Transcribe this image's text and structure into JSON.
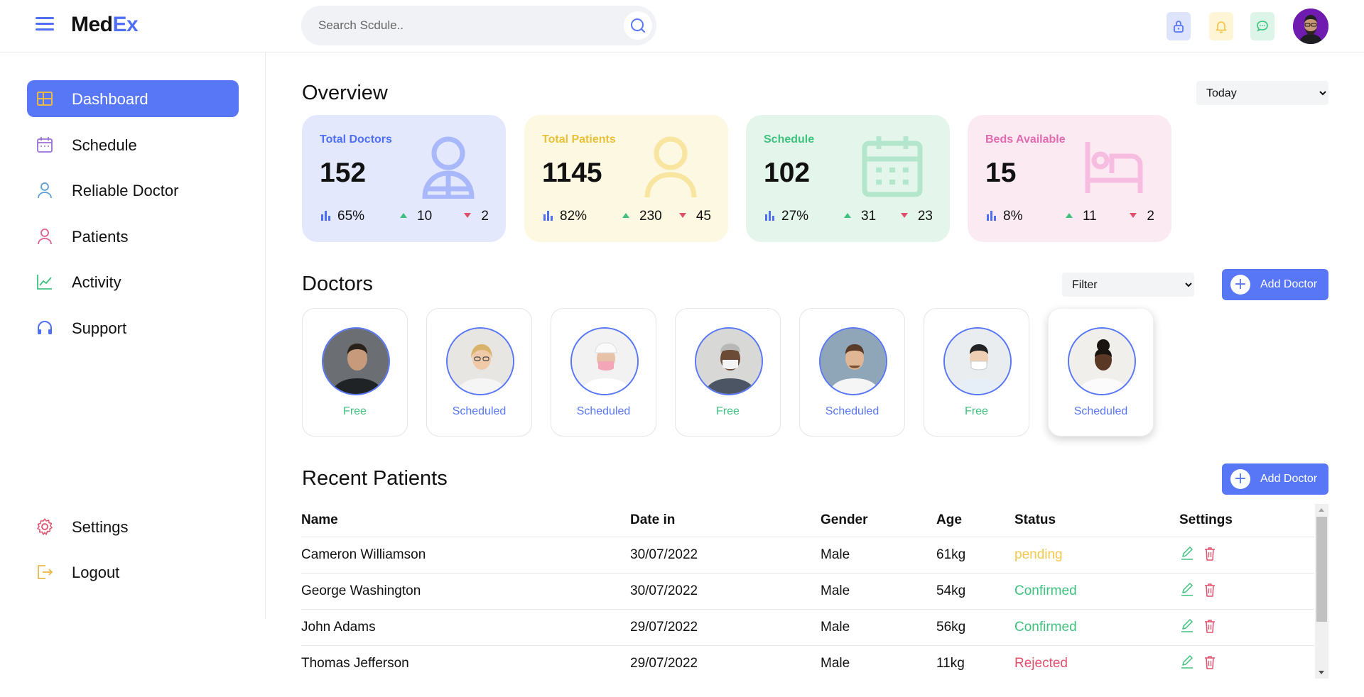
{
  "brand": {
    "part1": "Med",
    "part2": "Ex"
  },
  "search": {
    "placeholder": "Search Scdule.."
  },
  "colors": {
    "accent": "#5877f7",
    "free": "#3ec27e",
    "scheduled": "#5877f7",
    "pending": "#f2c94c",
    "confirmed": "#3ec27e",
    "rejected": "#e0506b"
  },
  "sidebar": {
    "items": [
      {
        "label": "Dashboard",
        "icon": "grid-icon"
      },
      {
        "label": "Schedule",
        "icon": "calendar-icon"
      },
      {
        "label": "Reliable Doctor",
        "icon": "doctor-icon"
      },
      {
        "label": "Patients",
        "icon": "user-icon"
      },
      {
        "label": "Activity",
        "icon": "chart-line-icon"
      },
      {
        "label": "Support",
        "icon": "headphones-icon"
      }
    ],
    "bottom": [
      {
        "label": "Settings",
        "icon": "gear-icon"
      },
      {
        "label": "Logout",
        "icon": "logout-icon"
      }
    ]
  },
  "overview": {
    "title": "Overview",
    "period": "Today",
    "cards": [
      {
        "title": "Total Doctors",
        "value": "152",
        "percent": "65%",
        "up": "10",
        "down": "2",
        "icon": "doctor-icon"
      },
      {
        "title": "Total Patients",
        "value": "1145",
        "percent": "82%",
        "up": "230",
        "down": "45",
        "icon": "user-icon"
      },
      {
        "title": "Schedule",
        "value": "102",
        "percent": "27%",
        "up": "31",
        "down": "23",
        "icon": "calendar-icon"
      },
      {
        "title": "Beds Available",
        "value": "15",
        "percent": "8%",
        "up": "11",
        "down": "2",
        "icon": "bed-icon"
      }
    ]
  },
  "doctors": {
    "title": "Doctors",
    "filter": "Filter",
    "add_label": "Add Doctor",
    "list": [
      {
        "status": "Free"
      },
      {
        "status": "Scheduled"
      },
      {
        "status": "Scheduled"
      },
      {
        "status": "Free"
      },
      {
        "status": "Scheduled"
      },
      {
        "status": "Free"
      },
      {
        "status": "Scheduled"
      }
    ]
  },
  "patients": {
    "title": "Recent Patients",
    "add_label": "Add Doctor",
    "columns": [
      "Name",
      "Date in",
      "Gender",
      "Age",
      "Status",
      "Settings"
    ],
    "rows": [
      {
        "name": "Cameron Williamson",
        "date": "30/07/2022",
        "gender": "Male",
        "age": "61kg",
        "status": "pending"
      },
      {
        "name": "George Washington",
        "date": "30/07/2022",
        "gender": "Male",
        "age": "54kg",
        "status": "Confirmed"
      },
      {
        "name": "John Adams",
        "date": "29/07/2022",
        "gender": "Male",
        "age": "56kg",
        "status": "Confirmed"
      },
      {
        "name": "Thomas Jefferson",
        "date": "29/07/2022",
        "gender": "Male",
        "age": "11kg",
        "status": "Rejected"
      }
    ]
  }
}
